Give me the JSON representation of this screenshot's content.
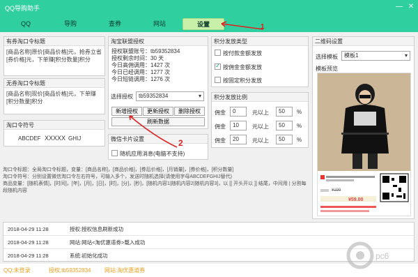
{
  "window": {
    "title": "QQ导购助手",
    "minimize": "—",
    "close": "✕"
  },
  "nav": {
    "tabs": [
      {
        "label": "QQ"
      },
      {
        "label": "导购"
      },
      {
        "label": "查券"
      },
      {
        "label": "网站"
      },
      {
        "label": "设置"
      }
    ]
  },
  "annotations": {
    "arrow1": "1",
    "arrow2": "2"
  },
  "qq_kw": {
    "header": "有券淘口令标题",
    "text": "[商品名称]原价[商品价格]元，抢券立省[券价格]元，下单赚[积分数量]积分"
  },
  "noq_kw": {
    "header": "无券淘口令标题",
    "text": "[商品名称]现价[商品价格]元，下单赚[积分数量]积分"
  },
  "kw_symbol": {
    "header": "淘口令符号",
    "values": [
      "ABCDEF",
      "XXXXX",
      "GHIJ"
    ]
  },
  "taobao_auth": {
    "header": "淘宝联盟授权",
    "lines": [
      "授权联盟账号：tb59352834",
      "授权剩余时间：30 天",
      "今日高佣调用：1427 次",
      "今日已经调用：1277 次",
      "今日短链调用：1276 次"
    ],
    "select_label": "选择授权",
    "select_value": "tb59352834",
    "buttons": {
      "new": "新增授权",
      "update": "更新授权",
      "delete": "删除授权",
      "refresh": "刷新数据"
    }
  },
  "wechat_card": {
    "header": "微信卡片设置",
    "random_msg": "随机应用消息(电脑不支持)"
  },
  "points_type": {
    "header": "积分发放类型",
    "options": [
      {
        "label": "按付款金额发放",
        "checked": false
      },
      {
        "label": "按佣金金额发放",
        "checked": true
      },
      {
        "label": "按固定积分发放",
        "checked": false
      }
    ]
  },
  "points_ratio": {
    "header": "积分发放比例",
    "rows": [
      {
        "label": "佣金",
        "value": "0",
        "mid": "元以上",
        "ratio": "50",
        "unit": "%"
      },
      {
        "label": "佣金",
        "value": "10",
        "mid": "元以上",
        "ratio": "50",
        "unit": "%"
      },
      {
        "label": "佣金",
        "value": "20",
        "mid": "元以上",
        "ratio": "50",
        "unit": "%"
      }
    ]
  },
  "qrcode": {
    "header": "二维码设置",
    "select_label": "选择模板",
    "select_value": "模板1",
    "preview_label": "模板预览",
    "price_old": "¥199",
    "price_new": "¥59.00"
  },
  "help_text": "淘口令标题：全局淘口令标题，变量：[商品名称]，[商品价格]，[券后价格]，[月销量]，[券价格]，[积分数量]\n淘口令符号：分别设置微信淘口令左右符号，可输入多个，发送时随机选择(请使用字母ABCDEFGHIJ替代)\n商品变量：[随机表情]，[时间]，[年]，[月]，[日]，[时]，[分]，[秒]，[随机内容1|随机内容2|随机内容3]，以 [[ 开头开以 ]] 结尾，中间用 | 分割每段随机内容",
  "log": [
    {
      "time": "2018-04-29 11:28",
      "msg": "授权:授权信息刷新成功"
    },
    {
      "time": "2018-04-29 11:28",
      "msg": "网站:网站<淘优惠道券>载入成功"
    },
    {
      "time": "2018-04-29 11:28",
      "msg": "系统:初始化成功"
    }
  ],
  "statusbar": {
    "qq": "QQ:未登录",
    "auth": "授权:tb59352834",
    "site": "网站:淘优惠道券"
  },
  "watermark": "pc6下载站"
}
